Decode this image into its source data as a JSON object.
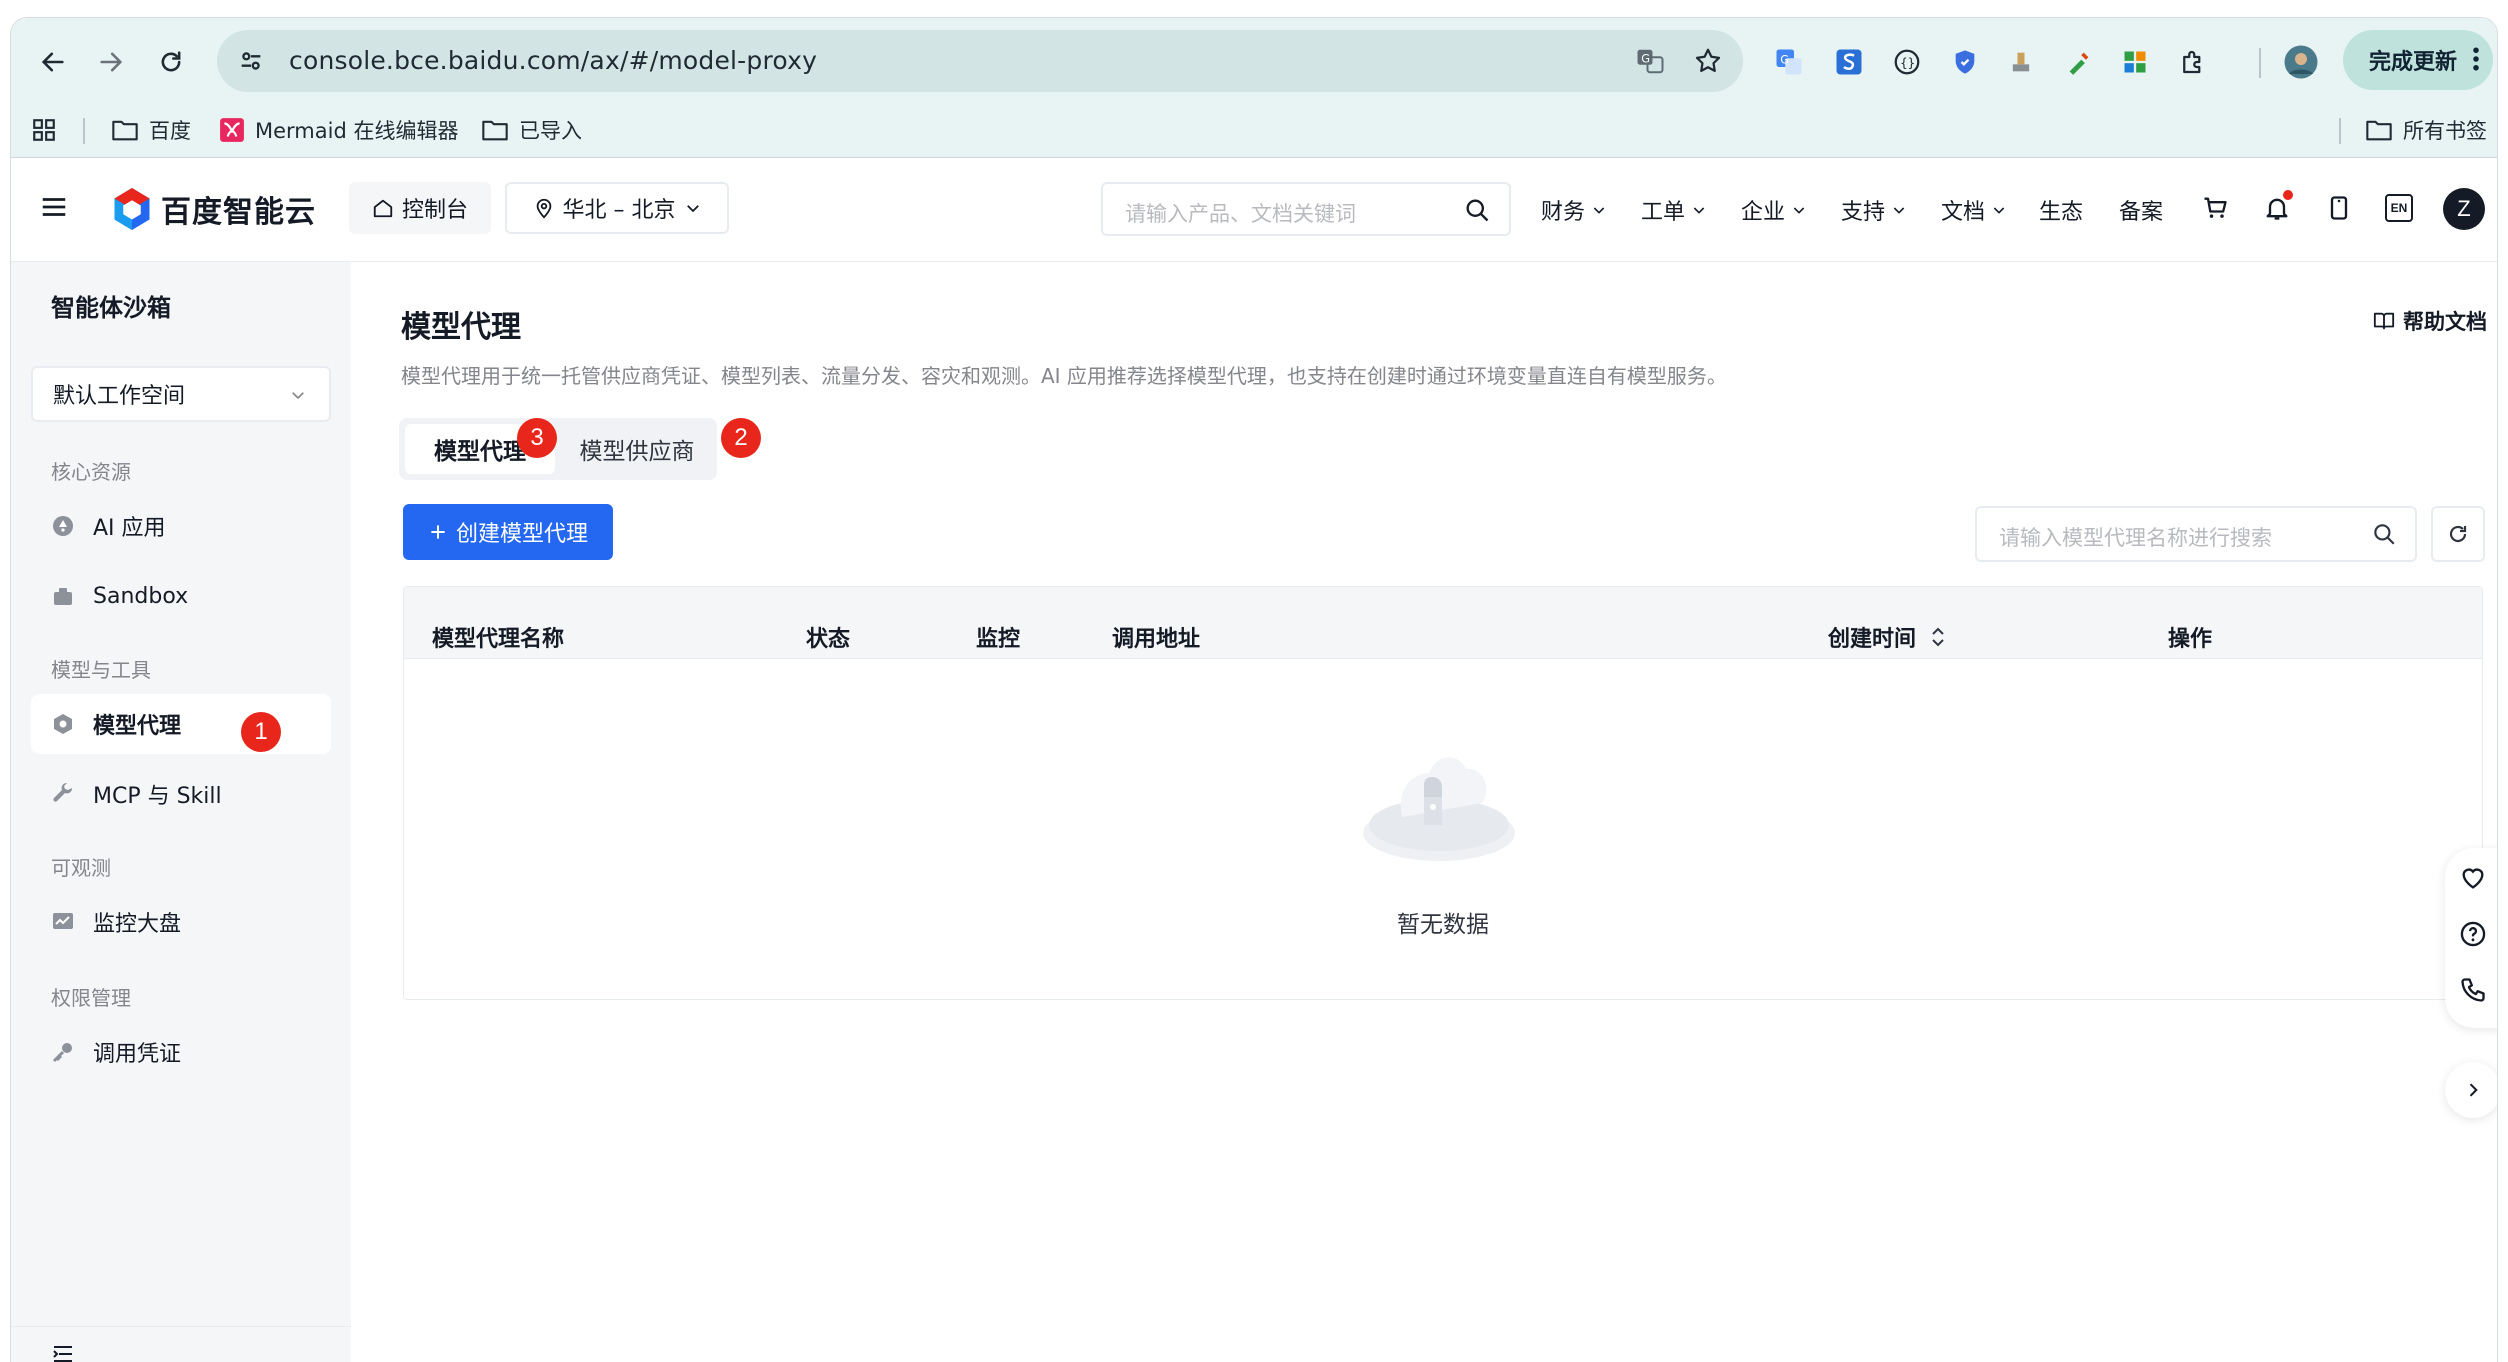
{
  "browser": {
    "url": "console.bce.baidu.com/ax/#/model-proxy",
    "update_label": "完成更新",
    "bookmarks": [
      "百度",
      "Mermaid 在线编辑器",
      "已导入"
    ],
    "all_bookmarks": "所有书签"
  },
  "topnav": {
    "brand": "百度智能云",
    "console": "控制台",
    "region": "华北 – 北京",
    "search_placeholder": "请输入产品、文档关键词",
    "menus": [
      "财务",
      "工单",
      "企业",
      "支持",
      "文档"
    ],
    "links": [
      "生态",
      "备案"
    ],
    "lang": "EN",
    "avatar": "Z"
  },
  "sidebar": {
    "title": "智能体沙箱",
    "workspace": "默认工作空间",
    "groups": [
      {
        "label": "核心资源",
        "items": [
          {
            "label": "AI 应用",
            "icon": "ai-app-icon"
          },
          {
            "label": "Sandbox",
            "icon": "sandbox-icon"
          }
        ]
      },
      {
        "label": "模型与工具",
        "items": [
          {
            "label": "模型代理",
            "icon": "model-proxy-icon"
          },
          {
            "label": "MCP 与 Skill",
            "icon": "wrench-icon"
          }
        ]
      },
      {
        "label": "可观测",
        "items": [
          {
            "label": "监控大盘",
            "icon": "monitor-icon"
          }
        ]
      },
      {
        "label": "权限管理",
        "items": [
          {
            "label": "调用凭证",
            "icon": "key-icon"
          }
        ]
      }
    ]
  },
  "page": {
    "title": "模型代理",
    "help": "帮助文档",
    "description": "模型代理用于统一托管供应商凭证、模型列表、流量分发、容灾和观测。AI 应用推荐选择模型代理，也支持在创建时通过环境变量直连自有模型服务。",
    "tabs": [
      "模型代理",
      "模型供应商"
    ],
    "create_button": "创建模型代理",
    "search_placeholder": "请输入模型代理名称进行搜索",
    "columns": [
      "模型代理名称",
      "状态",
      "监控",
      "调用地址",
      "创建时间",
      "操作"
    ],
    "empty_text": "暂无数据"
  },
  "badges": [
    "1",
    "2",
    "3"
  ],
  "colors": {
    "primary": "#2468f2",
    "badge": "#e8261b",
    "sidebar_bg": "#f5f6f8"
  }
}
